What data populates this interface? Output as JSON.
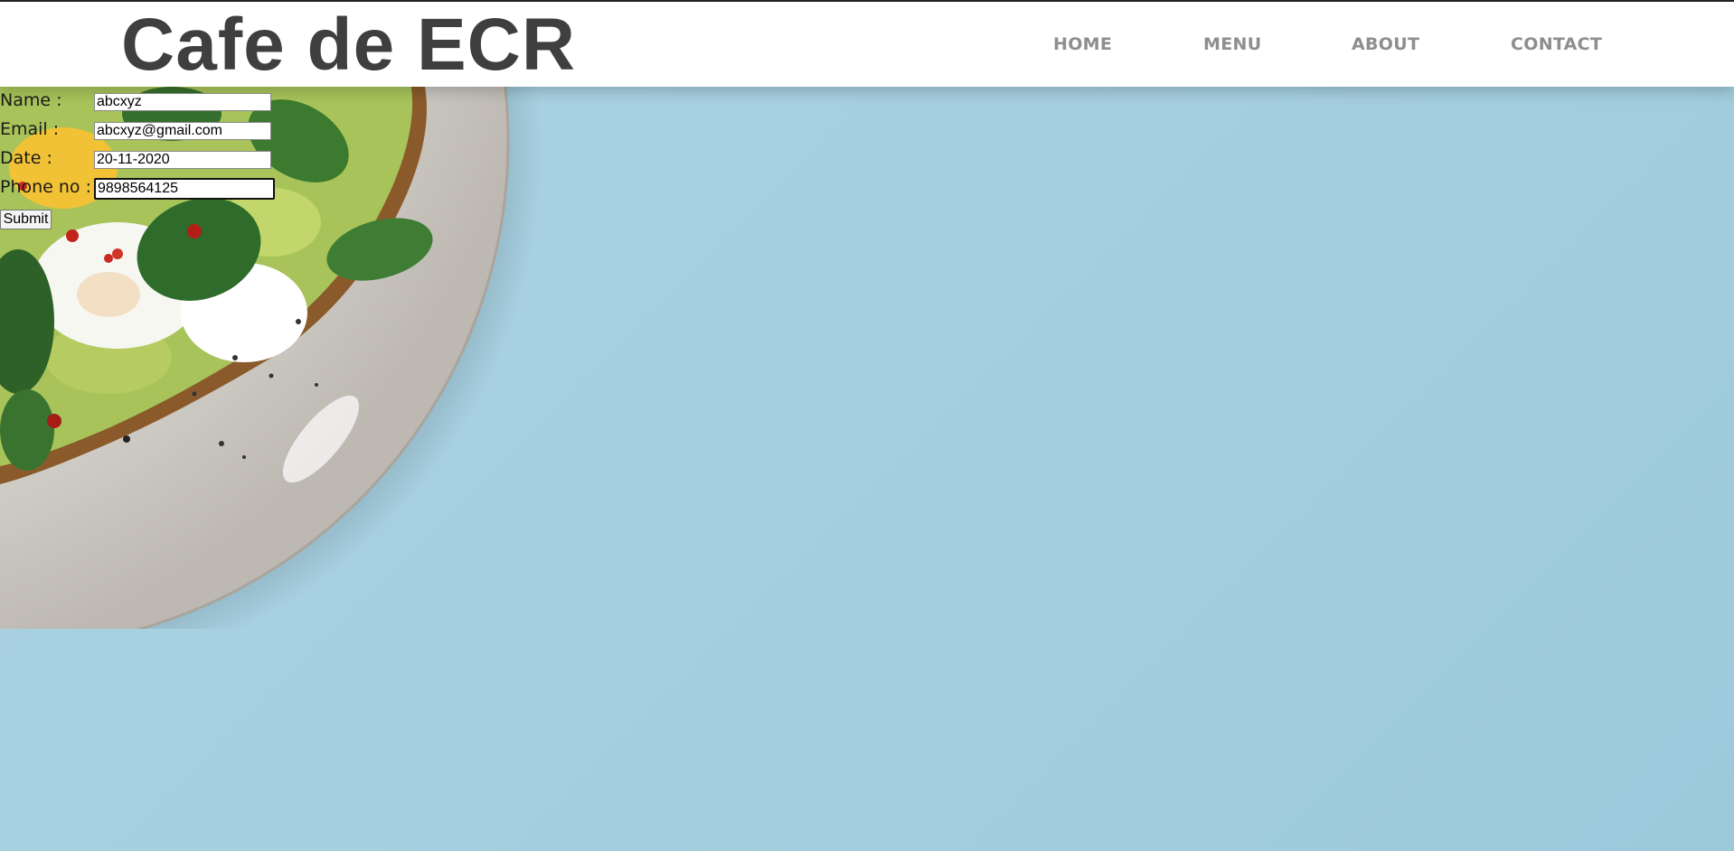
{
  "header": {
    "brand": "Cafe de ECR",
    "nav": [
      "HOME",
      "MENU",
      "ABOUT",
      "CONTACT"
    ]
  },
  "form": {
    "fields": [
      {
        "label": "Name :",
        "value": "abcxyz"
      },
      {
        "label": "Email :",
        "value": "abcxyz@gmail.com"
      },
      {
        "label": "Date :",
        "value": "20-11-2020"
      },
      {
        "label": "Phone no :",
        "value": "9898564125"
      }
    ],
    "submit_label": "Submit"
  },
  "colors": {
    "background": "#a9d2e2",
    "header_bg": "#ffffff",
    "brand_text": "#3f3f3f",
    "nav_text": "#8e8e8e"
  }
}
